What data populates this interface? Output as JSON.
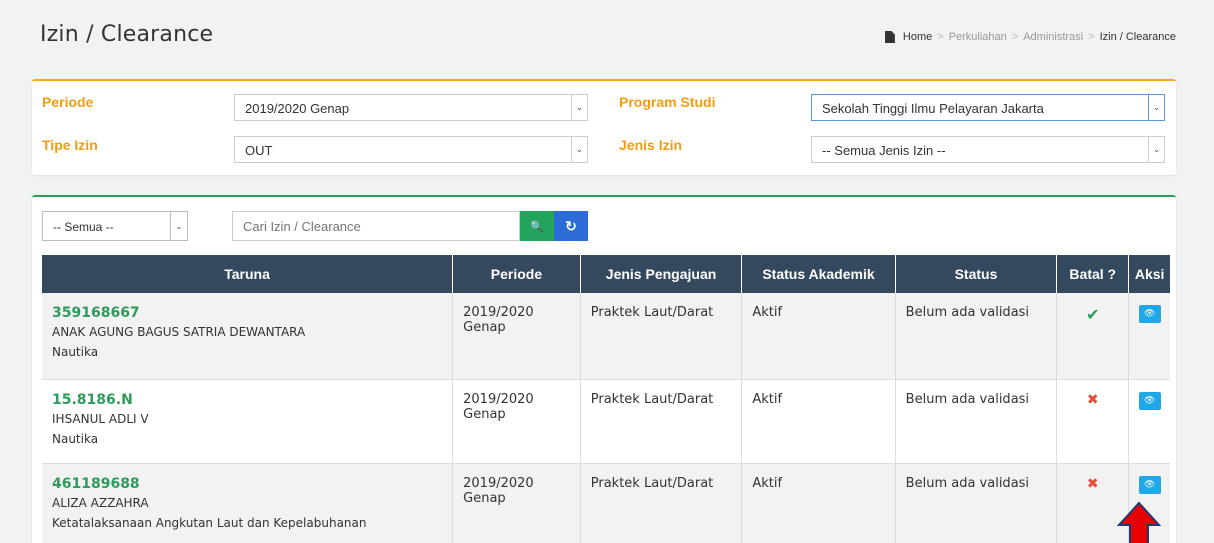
{
  "page": {
    "title": "Izin / Clearance",
    "breadcrumb": [
      "Home",
      "Perkuliahan",
      "Administrasi",
      "Izin / Clearance"
    ],
    "breadcrumb_sep": ">"
  },
  "filters": {
    "periode_label": "Periode",
    "periode_value": "2019/2020 Genap",
    "tipe_label": "Tipe Izin",
    "tipe_value": "OUT",
    "prodi_label": "Program Studi",
    "prodi_value": "Sekolah Tinggi Ilmu Pelayaran Jakarta",
    "jenis_label": "Jenis Izin",
    "jenis_value": "-- Semua Jenis Izin --"
  },
  "toolbar": {
    "status_select": "-- Semua --",
    "search_placeholder": "Cari Izin / Clearance"
  },
  "table": {
    "headers": [
      "Taruna",
      "Periode",
      "Jenis Pengajuan",
      "Status Akademik",
      "Status",
      "Batal ?",
      "Aksi"
    ],
    "rows": [
      {
        "nim": "359168667",
        "nama": "ANAK AGUNG BAGUS SATRIA DEWANTARA",
        "prodi": "Nautika",
        "periode": "2019/2020 Genap",
        "jenis": "Praktek Laut/Darat",
        "akademik": "Aktif",
        "status": "Belum ada validasi",
        "batal": "✔"
      },
      {
        "nim": "15.8186.N",
        "nama": "IHSANUL ADLI V",
        "prodi": "Nautika",
        "periode": "2019/2020 Genap",
        "jenis": "Praktek Laut/Darat",
        "akademik": "Aktif",
        "status": "Belum ada validasi",
        "batal": "✖"
      },
      {
        "nim": "461189688",
        "nama": "ALIZA AZZAHRA",
        "prodi": "Ketatalaksanaan Angkutan Laut dan Kepelabuhanan",
        "periode": "2019/2020 Genap",
        "jenis": "Praktek Laut/Darat",
        "akademik": "Aktif",
        "status": "Belum ada validasi",
        "batal": "✖"
      }
    ]
  },
  "colors": {
    "accent_orange": "#f39c12",
    "accent_green": "#2c9c5a",
    "header_dark": "#34495e",
    "action_blue": "#1fa8e8",
    "annotation_red": "#e60000"
  },
  "icons": {
    "check": "✔",
    "cross": "✖",
    "search": "🔍",
    "refresh": "↻",
    "eye": "👁",
    "chevron": "⌄"
  }
}
